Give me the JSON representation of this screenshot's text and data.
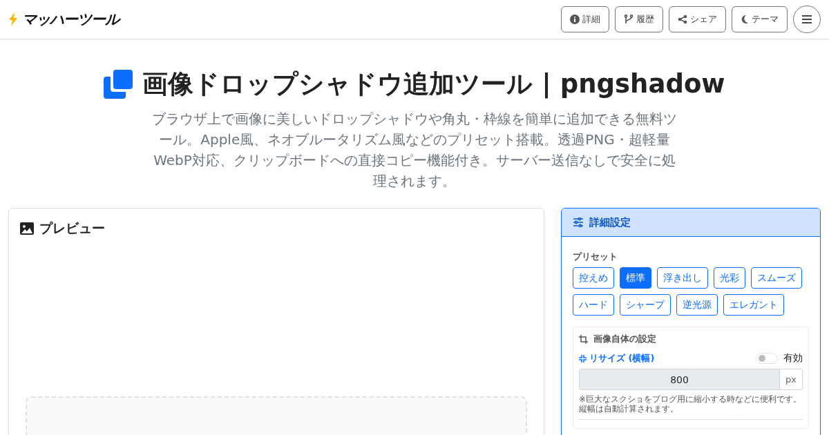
{
  "header": {
    "logo": "マッハーツール",
    "buttons": [
      {
        "kind": "info",
        "label": "詳細"
      },
      {
        "kind": "history",
        "label": "履歴"
      },
      {
        "kind": "share",
        "label": "シェア"
      },
      {
        "kind": "theme",
        "label": "テーマ"
      }
    ]
  },
  "hero": {
    "title": "画像ドロップシャドウ追加ツール | pngshadow",
    "description": "ブラウザ上で画像に美しいドロップシャドウや角丸・枠線を簡単に追加できる無料ツール。Apple風、ネオブルータリズム風などのプリセット搭載。透過PNG・超軽量WebP対応、クリップボードへの直接コピー機能付き。サーバー送信なしで安全に処理されます。"
  },
  "preview": {
    "title": "プレビュー"
  },
  "settings": {
    "title": "詳細設定",
    "preset_label": "プリセット",
    "presets": [
      {
        "label": "控えめ",
        "selected": false
      },
      {
        "label": "標準",
        "selected": true
      },
      {
        "label": "浮き出し",
        "selected": false
      },
      {
        "label": "光彩",
        "selected": false
      },
      {
        "label": "スムーズ",
        "selected": false
      },
      {
        "label": "ハード",
        "selected": false
      },
      {
        "label": "シャープ",
        "selected": false
      },
      {
        "label": "逆光源",
        "selected": false
      },
      {
        "label": "エレガント",
        "selected": false
      }
    ],
    "image_section": {
      "title": "画像自体の設定",
      "resize_label": "リサイズ (横幅)",
      "toggle_label": "有効",
      "enabled": false,
      "value": "800",
      "unit": "px",
      "note": "※巨大なスクショをブログ用に縮小する時などに便利です。縦幅は自動計算されます。"
    }
  }
}
